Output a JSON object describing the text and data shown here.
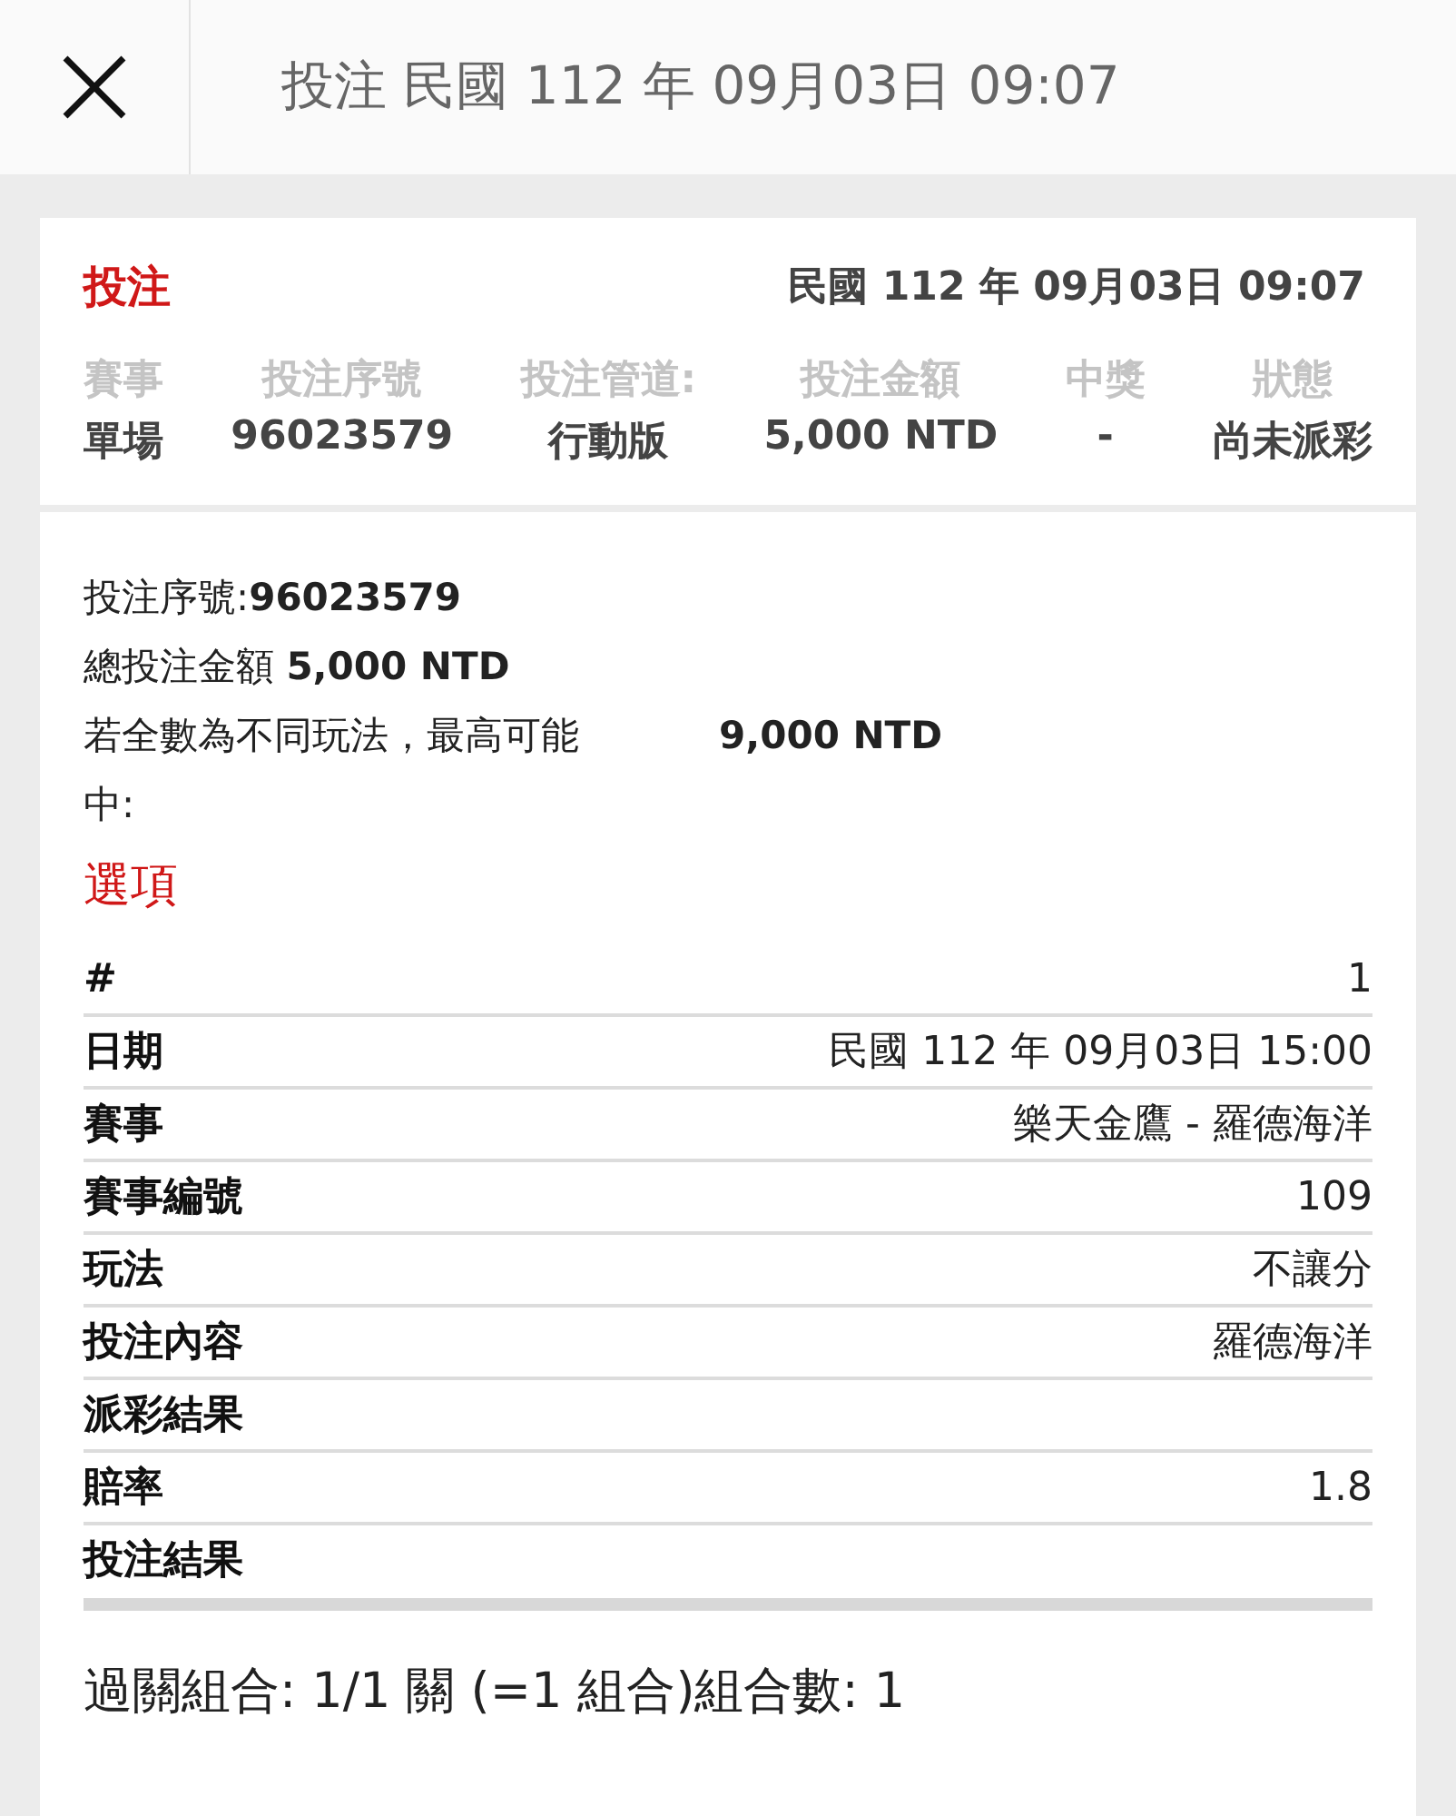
{
  "header": {
    "title": "投注 民國 112 年 09月03日 09:07"
  },
  "summary": {
    "heading": "投注",
    "datetime": "民國 112 年 09月03日 09:07",
    "columns": [
      "賽事",
      "投注序號",
      "投注管道:",
      "投注金額",
      "中獎",
      "狀態"
    ],
    "values": [
      "單場",
      "96023579",
      "行動版",
      "5,000 NTD",
      "-",
      "尚未派彩"
    ]
  },
  "details": {
    "serial_label": "投注序號:",
    "serial_value": "96023579",
    "total_label": "總投注金額",
    "total_value": "5,000 NTD",
    "max_label": "若全數為不同玩法，最高可能中:",
    "max_value": "9,000 NTD"
  },
  "options": {
    "heading": "選項",
    "rows": [
      {
        "label": "#",
        "value": "1"
      },
      {
        "label": "日期",
        "value": "民國 112 年 09月03日 15:00"
      },
      {
        "label": "賽事",
        "value": "樂天金鷹 - 羅德海洋"
      },
      {
        "label": "賽事編號",
        "value": "109"
      },
      {
        "label": "玩法",
        "value": "不讓分"
      },
      {
        "label": "投注內容",
        "value": "羅德海洋"
      },
      {
        "label": "派彩結果",
        "value": null
      },
      {
        "label": "賠率",
        "value": "1.8"
      },
      {
        "label": "投注結果",
        "value": null
      }
    ]
  },
  "combination": "過關組合: 1/1 關 (=1 組合)組合數: 1"
}
